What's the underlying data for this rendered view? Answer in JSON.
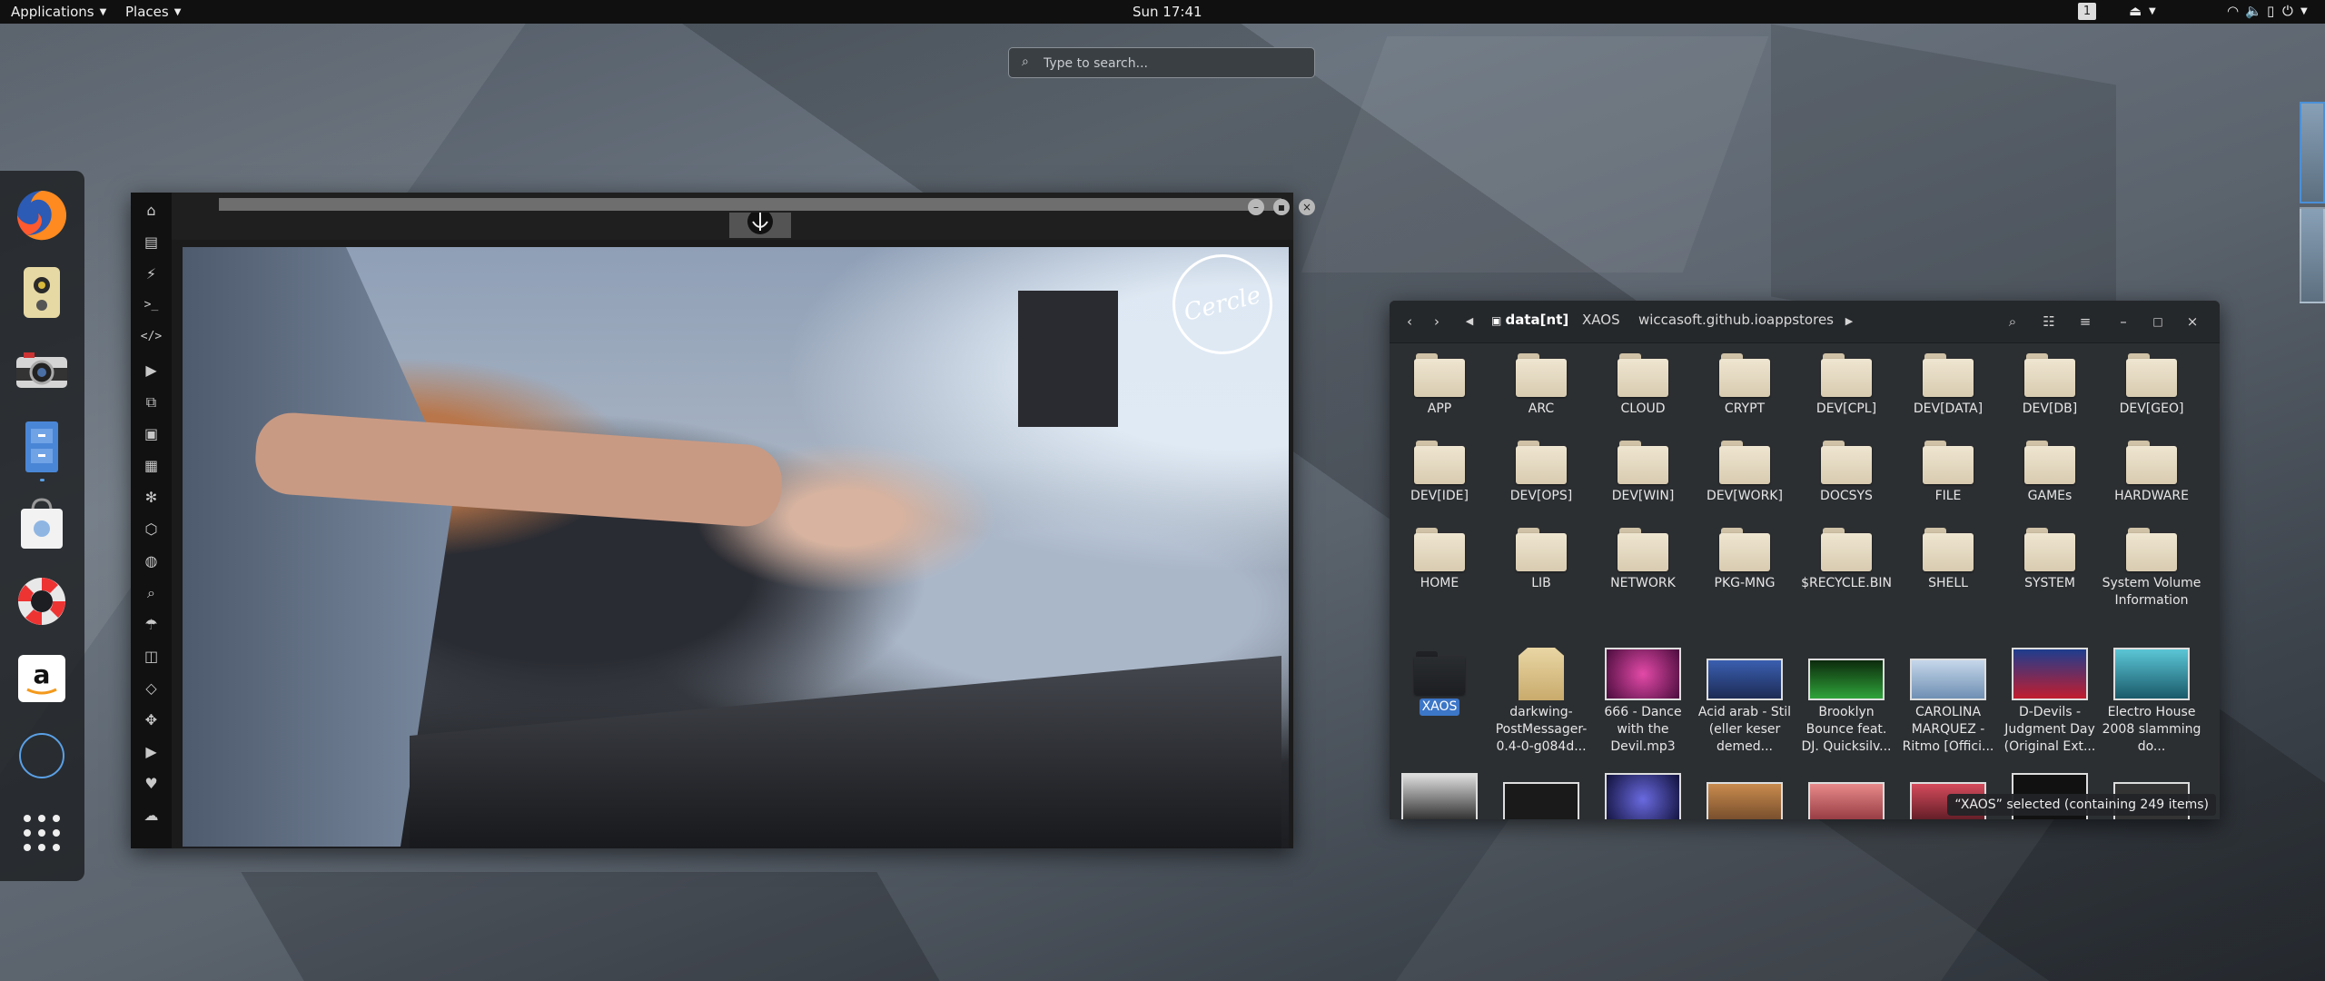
{
  "topbar": {
    "applications": "Applications",
    "places": "Places",
    "clock": "Sun 17:41",
    "workspace": "1"
  },
  "search": {
    "placeholder": "Type to search..."
  },
  "dock": {
    "apps": [
      {
        "name": "firefox-icon"
      },
      {
        "name": "speaker-app-icon"
      },
      {
        "name": "camera-icon"
      },
      {
        "name": "file-cabinet-icon"
      },
      {
        "name": "calendar-bag-icon"
      },
      {
        "name": "lifebuoy-help-icon"
      },
      {
        "name": "amazon-icon"
      },
      {
        "name": "empty-app-circle-icon"
      },
      {
        "name": "show-applications-grid-icon"
      }
    ]
  },
  "music": {
    "cover_logo": "Cercle"
  },
  "files": {
    "breadcrumbs": [
      "data[nt]",
      "XAOS",
      "wiccasoft.github.io",
      "appstores"
    ],
    "folders": [
      "APP",
      "ARC",
      "CLOUD",
      "CRYPT",
      "DEV[CPL]",
      "DEV[DATA]",
      "DEV[DB]",
      "DEV[GEO]",
      "DEV[IDE]",
      "DEV[OPS]",
      "DEV[WIN]",
      "DEV[WORK]",
      "DOCSYS",
      "FILE",
      "GAMEs",
      "HARDWARE",
      "HOME",
      "LIB",
      "NETWORK",
      "PKG-MNG",
      "$RECYCLE.BIN",
      "SHELL",
      "SYSTEM",
      "System Volume Information"
    ],
    "row4": [
      "XAOS",
      "darkwing-PostMessager-0.4-0-g084d...",
      "666 - Dance with the Devil.mp3",
      "Acid arab - Stil (eller keser demed...",
      "Brooklyn Bounce feat. DJ. Quicksilv...",
      "CAROLINA MARQUEZ - Ritmo [Offici...",
      "D-Devils - Judgment Day (Original Ext...",
      "Electro House 2008 slamming do..."
    ],
    "status": "“XAOS” selected  (containing 249 items)"
  }
}
